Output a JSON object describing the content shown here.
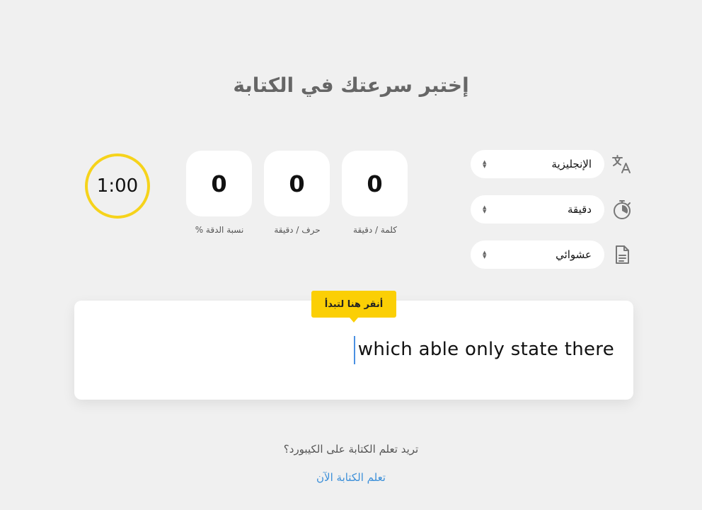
{
  "page": {
    "title": "إختبر سرعتك في الكتابة"
  },
  "timer": {
    "value": "1:00"
  },
  "stats": [
    {
      "value": "0",
      "label": "كلمة / دقيقة"
    },
    {
      "value": "0",
      "label": "حرف / دقيقة"
    },
    {
      "value": "0",
      "label": "نسبة الدقة %"
    }
  ],
  "options": {
    "language": {
      "value": "الإنجليزية",
      "icon": "translate-icon"
    },
    "duration": {
      "value": "دقيقة",
      "icon": "stopwatch-icon"
    },
    "text_type": {
      "value": "عشوائي",
      "icon": "document-icon"
    }
  },
  "typing": {
    "text": "which able only state there",
    "tooltip": "أنقر هنا لتبدأ"
  },
  "footer": {
    "question": "تريد تعلم الكتابة على الكيبورد؟",
    "link": "تعلم الكتابة الآن"
  },
  "colors": {
    "background": "#f0f0f0",
    "accent_yellow": "#fbcf05",
    "timer_ring": "#f6d31b",
    "link_blue": "#3b8fd9"
  }
}
